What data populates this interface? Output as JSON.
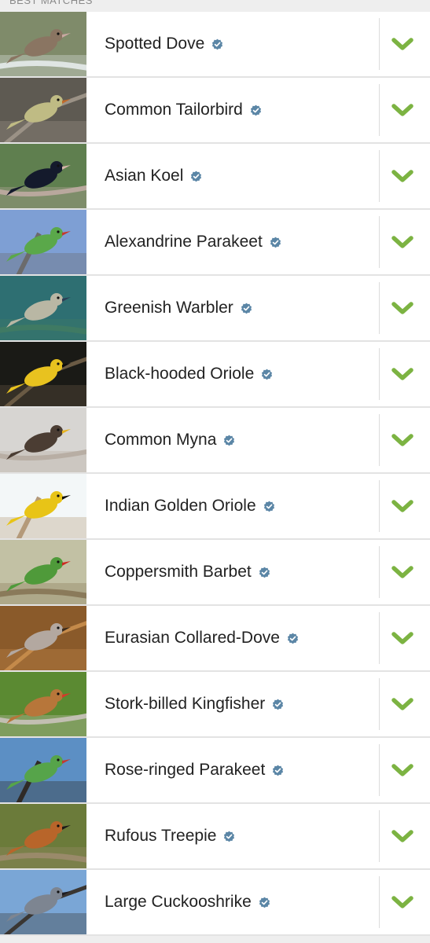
{
  "section_label": "BEST MATCHES",
  "colors": {
    "verified_badge": "#5b86a6",
    "check_green": "#7cb342",
    "row_border": "#e3e3e3"
  },
  "icons": {
    "verified": "verified-badge-icon",
    "select": "checkmark-icon"
  },
  "species": [
    {
      "name": "Spotted Dove",
      "photo": {
        "sky": "#7f8b6a",
        "ground": "#dfe5e3",
        "bird": "#8a7562",
        "accent": "#c9a8a2"
      }
    },
    {
      "name": "Common Tailorbird",
      "photo": {
        "sky": "#5e5a52",
        "ground": "#9b9286",
        "bird": "#bfbb84",
        "accent": "#c06a2a"
      }
    },
    {
      "name": "Asian Koel",
      "photo": {
        "sky": "#5f7f4f",
        "ground": "#b9a89d",
        "bird": "#141a2c",
        "accent": "#d4b4a8"
      }
    },
    {
      "name": "Alexandrine Parakeet",
      "photo": {
        "sky": "#7e9fd4",
        "ground": "#6b6b6b",
        "bird": "#5aa84a",
        "accent": "#c33a2e"
      }
    },
    {
      "name": "Greenish Warbler",
      "photo": {
        "sky": "#2e6f72",
        "ground": "#3f7a63",
        "bird": "#b9b7a4",
        "accent": "#2b3d55"
      }
    },
    {
      "name": "Black-hooded Oriole",
      "photo": {
        "sky": "#1a1a16",
        "ground": "#6a5a44",
        "bird": "#e8c21f",
        "accent": "#0c0c0c"
      }
    },
    {
      "name": "Common Myna",
      "photo": {
        "sky": "#d7d5d2",
        "ground": "#b8aea4",
        "bird": "#4b3d33",
        "accent": "#e6b21e"
      }
    },
    {
      "name": "Indian Golden Oriole",
      "photo": {
        "sky": "#f3f7f8",
        "ground": "#b49a7a",
        "bird": "#e8c417",
        "accent": "#111111"
      }
    },
    {
      "name": "Coppersmith Barbet",
      "photo": {
        "sky": "#c2c1a4",
        "ground": "#8a7a5a",
        "bird": "#4f9a3a",
        "accent": "#cc2b22"
      }
    },
    {
      "name": "Eurasian Collared-Dove",
      "photo": {
        "sky": "#8a5a2a",
        "ground": "#c48a4a",
        "bird": "#b3a8a0",
        "accent": "#3b2a1c"
      }
    },
    {
      "name": "Stork-billed Kingfisher",
      "photo": {
        "sky": "#5b8a32",
        "ground": "#c2bfb2",
        "bird": "#b7763a",
        "accent": "#d8382a"
      }
    },
    {
      "name": "Rose-ringed Parakeet",
      "photo": {
        "sky": "#5c8fc4",
        "ground": "#2f2a26",
        "bird": "#56a44a",
        "accent": "#c23a30"
      }
    },
    {
      "name": "Rufous Treepie",
      "photo": {
        "sky": "#6b7b3a",
        "ground": "#9a8a6a",
        "bird": "#b8652a",
        "accent": "#1c1a18"
      }
    },
    {
      "name": "Large Cuckooshrike",
      "photo": {
        "sky": "#7aa6d6",
        "ground": "#3a3632",
        "bird": "#7d8591",
        "accent": "#1d1d22"
      }
    }
  ]
}
